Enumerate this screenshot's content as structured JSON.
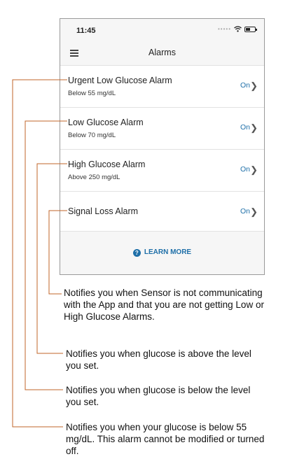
{
  "status_bar": {
    "time": "11:45"
  },
  "app_bar": {
    "title": "Alarms"
  },
  "alarms": [
    {
      "title": "Urgent Low Glucose Alarm",
      "subtitle": "Below 55 mg/dL",
      "status": "On"
    },
    {
      "title": "Low Glucose Alarm",
      "subtitle": "Below 70 mg/dL",
      "status": "On"
    },
    {
      "title": "High Glucose Alarm",
      "subtitle": "Above 250 mg/dL",
      "status": "On"
    },
    {
      "title": "Signal Loss Alarm",
      "subtitle": "",
      "status": "On"
    }
  ],
  "learn_more": "LEARN MORE",
  "callouts": [
    "Notifies you when Sensor is not communicating with the App and that you are not getting Low or High Glucose Alarms.",
    "Notifies you when glucose is above the level you set.",
    "Notifies you when glucose is below the level you set.",
    "Notifies you when your glucose is below 55 mg/dL. This alarm cannot be modified or turned off."
  ],
  "colors": {
    "accent": "#1e6fa8",
    "callout_line": "#c0662a"
  }
}
